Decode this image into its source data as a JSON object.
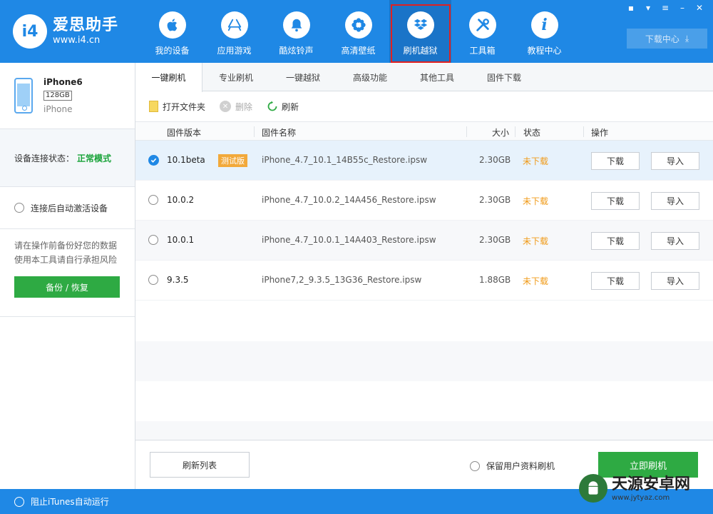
{
  "brand": {
    "title": "爱思助手",
    "url": "www.i4.cn",
    "mark": "i4"
  },
  "nav": [
    {
      "label": "我的设备",
      "icon": "apple-icon"
    },
    {
      "label": "应用游戏",
      "icon": "appstore-icon"
    },
    {
      "label": "酷炫铃声",
      "icon": "bell-icon"
    },
    {
      "label": "高清壁纸",
      "icon": "flower-icon"
    },
    {
      "label": "刷机越狱",
      "icon": "dropbox-icon",
      "active": true
    },
    {
      "label": "工具箱",
      "icon": "tools-icon"
    },
    {
      "label": "教程中心",
      "icon": "info-icon"
    }
  ],
  "window_controls": [
    "message-icon",
    "shirt-icon",
    "menu-icon",
    "minimize-icon",
    "close-icon"
  ],
  "download_center": "下载中心",
  "device": {
    "name": "iPhone6",
    "capacity": "128GB",
    "type": "iPhone"
  },
  "connection": {
    "label": "设备连接状态：",
    "status": "正常模式"
  },
  "auto_activate": "连接后自动激活设备",
  "warning": {
    "line1": "请在操作前备份好您的数据",
    "line2": "使用本工具请自行承担风险"
  },
  "backup_button": "备份 / 恢复",
  "statusbar": {
    "itunes": "阻止iTunes自动运行"
  },
  "tabs": [
    "一键刷机",
    "专业刷机",
    "一键越狱",
    "高级功能",
    "其他工具",
    "固件下载"
  ],
  "toolbar": {
    "open_folder": "打开文件夹",
    "delete": "删除",
    "refresh": "刷新"
  },
  "table": {
    "headers": {
      "version": "固件版本",
      "name": "固件名称",
      "size": "大小",
      "status": "状态",
      "action": "操作"
    },
    "rows": [
      {
        "version": "10.1beta",
        "badge": "测试版",
        "name": "iPhone_4.7_10.1_14B55c_Restore.ipsw",
        "size": "2.30GB",
        "status": "未下载",
        "download": "下载",
        "import": "导入",
        "selected": true
      },
      {
        "version": "10.0.2",
        "name": "iPhone_4.7_10.0.2_14A456_Restore.ipsw",
        "size": "2.30GB",
        "status": "未下载",
        "download": "下载",
        "import": "导入"
      },
      {
        "version": "10.0.1",
        "name": "iPhone_4.7_10.0.1_14A403_Restore.ipsw",
        "size": "2.30GB",
        "status": "未下载",
        "download": "下载",
        "import": "导入"
      },
      {
        "version": "9.3.5",
        "name": "iPhone7,2_9.3.5_13G36_Restore.ipsw",
        "size": "1.88GB",
        "status": "未下载",
        "download": "下载",
        "import": "导入"
      }
    ]
  },
  "footer": {
    "refresh_list": "刷新列表",
    "keep_data": "保留用户资料刷机",
    "flash_now": "立即刷机"
  },
  "watermark": {
    "title": "天源安卓网",
    "url": "www.jytyaz.com"
  },
  "colors": {
    "primary": "#1f88e5",
    "green": "#2eaa43",
    "orange": "#f09a17",
    "highlight": "#e02020"
  }
}
